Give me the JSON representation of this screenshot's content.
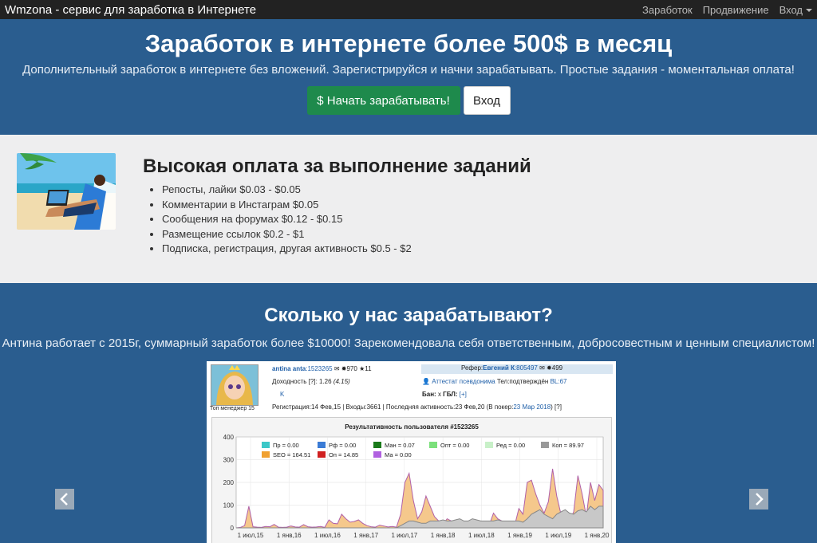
{
  "navbar": {
    "brand": "Wmzona - сервис для заработка в Интернете",
    "links": [
      "Заработок",
      "Продвижение",
      "Вход"
    ]
  },
  "hero": {
    "title": "Заработок в интернете более 500$ в месяц",
    "subtitle": "Дополнительный заработок в интернете без вложений. Зарегистрируйся и начни зарабатывать. Простые задания - моментальная оплата!",
    "start_button": "$ Начать зарабатывать!",
    "login_button": "Вход"
  },
  "features": {
    "title": "Высокая оплата за выполнение заданий",
    "items": [
      "Репосты, лайки $0.03 - $0.05",
      "Комментарии в Инстаграм $0.05",
      "Сообщения на форумах $0.12 - $0.15",
      "Размещение ссылок $0.2 - $1",
      "Подписка, регистрация, другая активность $0.5 - $2"
    ]
  },
  "earn": {
    "title": "Сколько у нас зарабатывают?",
    "text": "Антина работает с 2015г, суммарный заработок более $10000! Зарекомендовала себя ответственным, добросовестным и ценным специалистом!"
  },
  "profile": {
    "caption": "Топ менеджер 15",
    "name": "antina anta",
    "id": ":1523265",
    "stat1": "970",
    "stat2": "11",
    "referrer_label": "Рефер:",
    "referrer": "Евгений К",
    "referrer_id": ":805497",
    "referrer_stat": "499",
    "income_label": "Доходность",
    "income_val": ": 1.26",
    "income_paren": "(4.15)",
    "attest": "Аттестат псевдонима",
    "phone": "Тел:подтверждён",
    "bl": "BL:67",
    "k": "K",
    "ban": "Бан:",
    "ban_val": "x",
    "gbl": "ГБЛ:",
    "gbl_val": "[+]",
    "reg": "Регистрация:14 Фев,15 | Входы:3661 | Последняя активность:23 Фев,20 (В покер:",
    "reg_link": "23 Мар 2018",
    "reg_end": ")"
  },
  "chart_data": {
    "type": "area",
    "title": "Результативность пользователя #1523265",
    "ylim": [
      0,
      400
    ],
    "yticks": [
      "400",
      "300",
      "200",
      "100",
      "0"
    ],
    "xticks": [
      "1 июл,15",
      "1 янв,16",
      "1 июл,16",
      "1 янв,17",
      "1 июл,17",
      "1 янв,18",
      "1 июл,18",
      "1 янв,19",
      "1 июл,19",
      "1 янв,20"
    ],
    "legend": [
      {
        "label": "Пр = 0.00",
        "color": "#3cc8c8"
      },
      {
        "label": "Рф = 0.00",
        "color": "#3a7bd5"
      },
      {
        "label": "Ман = 0.07",
        "color": "#1a7a1a"
      },
      {
        "label": "Опт = 0.00",
        "color": "#7be07b"
      },
      {
        "label": "Ред = 0.00",
        "color": "#c8f0c8"
      },
      {
        "label": "Коп = 89.97",
        "color": "#999999"
      },
      {
        "label": "SEO = 164.51",
        "color": "#f0a030"
      },
      {
        "label": "Оп = 14.85",
        "color": "#d02020"
      },
      {
        "label": "Ма = 0.00",
        "color": "#b060e0"
      }
    ],
    "series": [
      {
        "name": "SEO",
        "color": "#f5c88c",
        "values": [
          0,
          2,
          10,
          95,
          5,
          3,
          2,
          6,
          5,
          15,
          3,
          2,
          3,
          8,
          4,
          3,
          14,
          5,
          3,
          4,
          6,
          2,
          35,
          20,
          18,
          60,
          40,
          25,
          28,
          35,
          20,
          10,
          5,
          3,
          12,
          8,
          4,
          6,
          3,
          60,
          200,
          240,
          120,
          40,
          70,
          140,
          95,
          50,
          30,
          15,
          40,
          30,
          30,
          20,
          10,
          5,
          35,
          20,
          15,
          10,
          12,
          65,
          40,
          30,
          25,
          15,
          10,
          85,
          60,
          200,
          210,
          150,
          100,
          65,
          115,
          260,
          140,
          60,
          40,
          30,
          70,
          230,
          150,
          50,
          200,
          120,
          190,
          165
        ]
      },
      {
        "name": "Коп",
        "values": [
          0,
          0,
          0,
          0,
          0,
          0,
          0,
          0,
          0,
          0,
          0,
          0,
          0,
          0,
          0,
          0,
          0,
          0,
          0,
          0,
          0,
          0,
          0,
          0,
          0,
          0,
          0,
          0,
          0,
          0,
          0,
          0,
          0,
          0,
          0,
          0,
          0,
          0,
          0,
          10,
          20,
          30,
          30,
          25,
          20,
          20,
          30,
          30,
          30,
          35,
          30,
          30,
          35,
          40,
          30,
          30,
          40,
          35,
          30,
          30,
          30,
          30,
          35,
          30,
          30,
          30,
          30,
          30,
          25,
          40,
          60,
          70,
          80,
          60,
          50,
          40,
          60,
          70,
          80,
          65,
          60,
          75,
          80,
          70,
          95,
          80,
          95,
          95
        ]
      }
    ]
  }
}
